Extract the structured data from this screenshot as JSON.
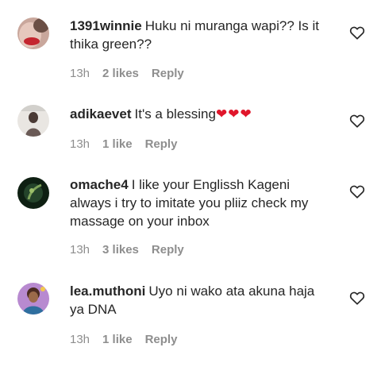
{
  "comments": [
    {
      "username": "1391winnie",
      "text": "Huku ni muranga wapi?? Is it thika green??",
      "time": "13h",
      "likes": "2 likes",
      "reply": "Reply"
    },
    {
      "username": "adikaevet",
      "text": "It's a blessing",
      "emoji": "❤❤❤",
      "time": "13h",
      "likes": "1 like",
      "reply": "Reply"
    },
    {
      "username": "omache4",
      "text": "I like your Englissh Kageni always i try to imitate you pliiz check my massage on your inbox",
      "time": "13h",
      "likes": "3 likes",
      "reply": "Reply"
    },
    {
      "username": "lea.muthoni",
      "text": "Uyo ni wako ata akuna haja ya DNA",
      "time": "13h",
      "likes": "1 like",
      "reply": "Reply"
    }
  ],
  "icons": {
    "like": "heart-outline-icon",
    "emoji": "red-heart-icon"
  },
  "colors": {
    "text": "#262626",
    "meta": "#8e8e8e",
    "emoji_heart": "#e0162b"
  }
}
